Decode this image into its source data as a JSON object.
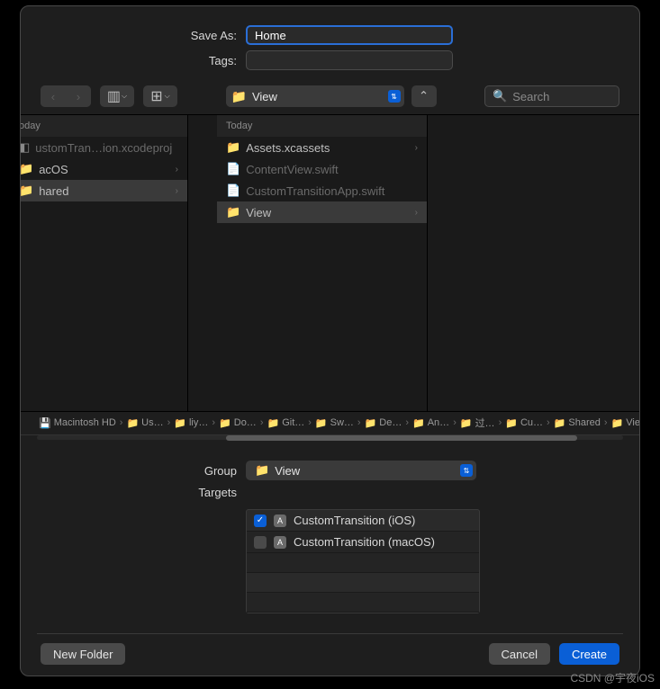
{
  "form": {
    "saveAsLabel": "Save As:",
    "saveAsValue": "Home",
    "tagsLabel": "Tags:",
    "tagsValue": ""
  },
  "toolbar": {
    "pathDropdown": "View",
    "searchPlaceholder": "Search"
  },
  "columns": {
    "col1": {
      "header": "oday",
      "items": [
        {
          "name": "ustomTran…ion.xcodeproj",
          "type": "proj",
          "dimmed": true
        },
        {
          "name": "acOS",
          "type": "folder",
          "dimmed": false,
          "chevron": true
        },
        {
          "name": "hared",
          "type": "folder",
          "selected": true,
          "chevron": true
        }
      ]
    },
    "col2": {
      "header": "Today",
      "items": [
        {
          "name": "Assets.xcassets",
          "type": "folder",
          "chevron": true
        },
        {
          "name": "ContentView.swift",
          "type": "doc",
          "dimmed": true
        },
        {
          "name": "CustomTransitionApp.swift",
          "type": "doc",
          "dimmed": true
        },
        {
          "name": "View",
          "type": "folder",
          "selected": true,
          "chevron": true
        }
      ]
    }
  },
  "breadcrumbs": [
    {
      "name": "Macintosh HD",
      "icon": "disk"
    },
    {
      "name": "Us…",
      "icon": "folder"
    },
    {
      "name": "liy…",
      "icon": "folder"
    },
    {
      "name": "Do…",
      "icon": "folder"
    },
    {
      "name": "Git…",
      "icon": "folder"
    },
    {
      "name": "Sw…",
      "icon": "folder"
    },
    {
      "name": "De…",
      "icon": "folder"
    },
    {
      "name": "An…",
      "icon": "folder"
    },
    {
      "name": "过…",
      "icon": "folder"
    },
    {
      "name": "Cu…",
      "icon": "folder"
    },
    {
      "name": "Shared",
      "icon": "folder"
    },
    {
      "name": "View",
      "icon": "folder"
    }
  ],
  "groupForm": {
    "groupLabel": "Group",
    "groupValue": "View",
    "targetsLabel": "Targets",
    "targets": [
      {
        "checked": true,
        "name": "CustomTransition (iOS)"
      },
      {
        "checked": false,
        "name": "CustomTransition (macOS)"
      }
    ]
  },
  "footer": {
    "newFolder": "New Folder",
    "cancel": "Cancel",
    "create": "Create"
  },
  "watermark": "CSDN @宇夜iOS"
}
